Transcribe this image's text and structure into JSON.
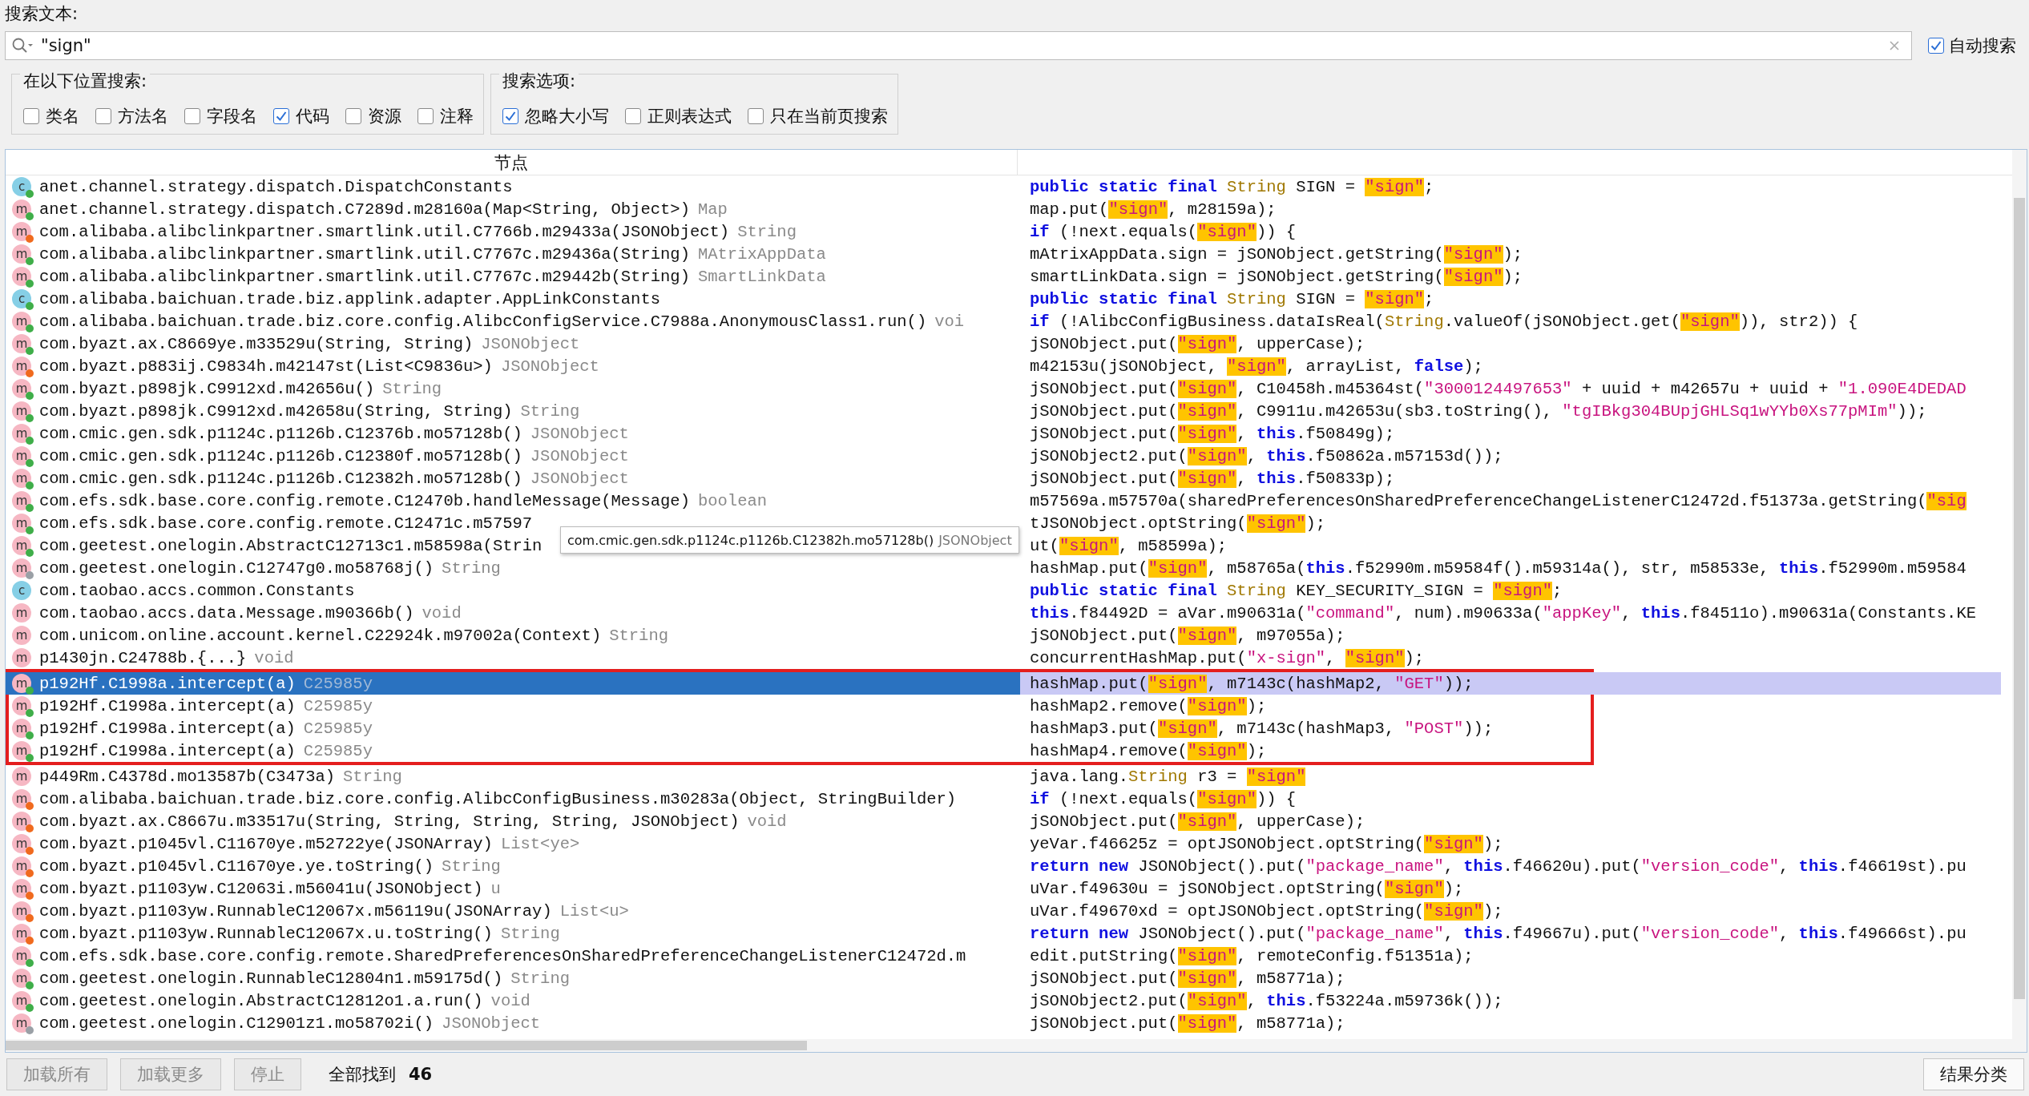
{
  "search": {
    "label": "搜索文本:",
    "value": "\"sign\"",
    "auto_search": {
      "label": "自动搜索",
      "checked": true
    }
  },
  "groups": [
    {
      "title": "在以下位置搜索:",
      "options": [
        {
          "label": "类名",
          "checked": false
        },
        {
          "label": "方法名",
          "checked": false
        },
        {
          "label": "字段名",
          "checked": false
        },
        {
          "label": "代码",
          "checked": true
        },
        {
          "label": "资源",
          "checked": false
        },
        {
          "label": "注释",
          "checked": false
        }
      ]
    },
    {
      "title": "搜索选项:",
      "options": [
        {
          "label": "忽略大小写",
          "checked": true
        },
        {
          "label": "正则表达式",
          "checked": false
        },
        {
          "label": "只在当前页搜索",
          "checked": false
        }
      ]
    }
  ],
  "table": {
    "columns": [
      "节点"
    ]
  },
  "rows": [
    {
      "kind": "class",
      "icon": "c",
      "color": "#3fae49",
      "name": "anet.channel.strategy.dispatch.DispatchConstants",
      "selected": false,
      "boxed": false,
      "code": [
        {
          "kind": "keyword",
          "text": "public static final "
        },
        {
          "kind": "type",
          "text": "String"
        },
        {
          "kind": "plain",
          "text": " SIGN = "
        },
        {
          "kind": "match",
          "text": "\"sign\""
        },
        {
          "kind": "plain",
          "text": ";"
        }
      ]
    },
    {
      "kind": "method",
      "icon": "m",
      "color": "#3fae49",
      "name": "anet.channel.strategy.dispatch.C7289d.m28160a(Map<String, Object>)",
      "type": "Map",
      "selected": false,
      "boxed": false,
      "code": [
        {
          "kind": "plain",
          "text": "map.put("
        },
        {
          "kind": "match",
          "text": "\"sign\""
        },
        {
          "kind": "plain",
          "text": ", m28159a);"
        }
      ]
    },
    {
      "kind": "method",
      "icon": "m",
      "color": "#f06a1e",
      "name": "com.alibaba.alibclinkpartner.smartlink.util.C7766b.m29433a(JSONObject)",
      "type": "String",
      "selected": false,
      "boxed": false,
      "code": [
        {
          "kind": "keyword",
          "text": "if"
        },
        {
          "kind": "plain",
          "text": " (!next.equals("
        },
        {
          "kind": "match",
          "text": "\"sign\""
        },
        {
          "kind": "plain",
          "text": ")) {"
        }
      ]
    },
    {
      "kind": "method",
      "icon": "m",
      "color": "#3fae49",
      "name": "com.alibaba.alibclinkpartner.smartlink.util.C7767c.m29436a(String)",
      "type": "MAtrixAppData",
      "selected": false,
      "boxed": false,
      "code": [
        {
          "kind": "plain",
          "text": "mAtrixAppData.sign = jSONObject.getString("
        },
        {
          "kind": "match",
          "text": "\"sign\""
        },
        {
          "kind": "plain",
          "text": ");"
        }
      ]
    },
    {
      "kind": "method",
      "icon": "m",
      "color": "#3fae49",
      "name": "com.alibaba.alibclinkpartner.smartlink.util.C7767c.m29442b(String)",
      "type": "SmartLinkData",
      "selected": false,
      "boxed": false,
      "code": [
        {
          "kind": "plain",
          "text": "smartLinkData.sign = jSONObject.getString("
        },
        {
          "kind": "match",
          "text": "\"sign\""
        },
        {
          "kind": "plain",
          "text": ");"
        }
      ]
    },
    {
      "kind": "class",
      "icon": "c",
      "color": "#3fae49",
      "name": "com.alibaba.baichuan.trade.biz.applink.adapter.AppLinkConstants",
      "selected": false,
      "boxed": false,
      "code": [
        {
          "kind": "keyword",
          "text": "public static final "
        },
        {
          "kind": "type",
          "text": "String"
        },
        {
          "kind": "plain",
          "text": " SIGN = "
        },
        {
          "kind": "match",
          "text": "\"sign\""
        },
        {
          "kind": "plain",
          "text": ";"
        }
      ]
    },
    {
      "kind": "method",
      "icon": "m",
      "color": "#3fae49",
      "name": "com.alibaba.baichuan.trade.biz.core.config.AlibcConfigService.C7988a.AnonymousClass1.run()",
      "type": "voi",
      "selected": false,
      "boxed": false,
      "code": [
        {
          "kind": "keyword",
          "text": "if"
        },
        {
          "kind": "plain",
          "text": " (!AlibcConfigBusiness.dataIsReal("
        },
        {
          "kind": "type",
          "text": "String"
        },
        {
          "kind": "plain",
          "text": ".valueOf(jSONObject.get("
        },
        {
          "kind": "match",
          "text": "\"sign\""
        },
        {
          "kind": "plain",
          "text": ")), str2)) {"
        }
      ]
    },
    {
      "kind": "method",
      "icon": "m",
      "color": "#3fae49",
      "name": "com.byazt.ax.C8669ye.m33529u(String, String)",
      "type": "JSONObject",
      "selected": false,
      "boxed": false,
      "code": [
        {
          "kind": "plain",
          "text": "jSONObject.put("
        },
        {
          "kind": "match",
          "text": "\"sign\""
        },
        {
          "kind": "plain",
          "text": ", upperCase);"
        }
      ]
    },
    {
      "kind": "method",
      "icon": "m",
      "color": "#f06a1e",
      "name": "com.byazt.p883ij.C9834h.m42147st(List<C9836u>)",
      "type": "JSONObject",
      "selected": false,
      "boxed": false,
      "code": [
        {
          "kind": "plain",
          "text": "m42153u(jSONObject, "
        },
        {
          "kind": "match",
          "text": "\"sign\""
        },
        {
          "kind": "plain",
          "text": ", arrayList, "
        },
        {
          "kind": "keyword",
          "text": "false"
        },
        {
          "kind": "plain",
          "text": ");"
        }
      ]
    },
    {
      "kind": "method",
      "icon": "m",
      "color": "#3fae49",
      "name": "com.byazt.p898jk.C9912xd.m42656u()",
      "type": "String",
      "selected": false,
      "boxed": false,
      "code": [
        {
          "kind": "plain",
          "text": "jSONObject.put("
        },
        {
          "kind": "match",
          "text": "\"sign\""
        },
        {
          "kind": "plain",
          "text": ", C10458h.m45364st("
        },
        {
          "kind": "string",
          "text": "\"3000124497653\""
        },
        {
          "kind": "plain",
          "text": " + uuid + m42657u + uuid + "
        },
        {
          "kind": "string",
          "text": "\"1.090E4DEDAD"
        }
      ]
    },
    {
      "kind": "method",
      "icon": "m",
      "color": "#3fae49",
      "name": "com.byazt.p898jk.C9912xd.m42658u(String, String)",
      "type": "String",
      "selected": false,
      "boxed": false,
      "code": [
        {
          "kind": "plain",
          "text": "jSONObject.put("
        },
        {
          "kind": "match",
          "text": "\"sign\""
        },
        {
          "kind": "plain",
          "text": ", C9911u.m42653u(sb3.toString(), "
        },
        {
          "kind": "string",
          "text": "\"tgIBkg304BUpjGHLSq1wYYb0Xs77pMIm\""
        },
        {
          "kind": "plain",
          "text": "));"
        }
      ]
    },
    {
      "kind": "method",
      "icon": "m",
      "color": "#3fae49",
      "name": "com.cmic.gen.sdk.p1124c.p1126b.C12376b.mo57128b()",
      "type": "JSONObject",
      "selected": false,
      "boxed": false,
      "code": [
        {
          "kind": "plain",
          "text": "jSONObject.put("
        },
        {
          "kind": "match",
          "text": "\"sign\""
        },
        {
          "kind": "plain",
          "text": ", "
        },
        {
          "kind": "keyword",
          "text": "this"
        },
        {
          "kind": "plain",
          "text": ".f50849g);"
        }
      ]
    },
    {
      "kind": "method",
      "icon": "m",
      "color": "#3fae49",
      "name": "com.cmic.gen.sdk.p1124c.p1126b.C12380f.mo57128b()",
      "type": "JSONObject",
      "selected": false,
      "boxed": false,
      "code": [
        {
          "kind": "plain",
          "text": "jSONObject2.put("
        },
        {
          "kind": "match",
          "text": "\"sign\""
        },
        {
          "kind": "plain",
          "text": ", "
        },
        {
          "kind": "keyword",
          "text": "this"
        },
        {
          "kind": "plain",
          "text": ".f50862a.m57153d());"
        }
      ]
    },
    {
      "kind": "method",
      "icon": "m",
      "color": "#3fae49",
      "name": "com.cmic.gen.sdk.p1124c.p1126b.C12382h.mo57128b()",
      "type": "JSONObject",
      "selected": false,
      "boxed": false,
      "code": [
        {
          "kind": "plain",
          "text": "jSONObject.put("
        },
        {
          "kind": "match",
          "text": "\"sign\""
        },
        {
          "kind": "plain",
          "text": ", "
        },
        {
          "kind": "keyword",
          "text": "this"
        },
        {
          "kind": "plain",
          "text": ".f50833p);"
        }
      ]
    },
    {
      "kind": "method",
      "icon": "m",
      "color": "#3fae49",
      "name": "com.efs.sdk.base.core.config.remote.C12470b.handleMessage(Message)",
      "type": "boolean",
      "selected": false,
      "boxed": false,
      "code": [
        {
          "kind": "plain",
          "text": "m57569a.m57570a(sharedPreferencesOnSharedPreferenceChangeListenerC12472d.f51373a.getString("
        },
        {
          "kind": "match",
          "text": "\"sig"
        }
      ]
    },
    {
      "kind": "method",
      "icon": "m",
      "color": "#3fae49",
      "name": "com.efs.sdk.base.core.config.remote.C12471c.m57597",
      "selected": false,
      "boxed": false,
      "code": [
        {
          "kind": "plain",
          "text": "tJSONObject.optString("
        },
        {
          "kind": "match",
          "text": "\"sign\""
        },
        {
          "kind": "plain",
          "text": ");"
        }
      ]
    },
    {
      "kind": "method",
      "icon": "m",
      "color": "#3fae49",
      "name": "com.geetest.onelogin.AbstractC12713c1.m58598a(Strin",
      "selected": false,
      "boxed": false,
      "code": [
        {
          "kind": "plain",
          "text": "ut("
        },
        {
          "kind": "match",
          "text": "\"sign\""
        },
        {
          "kind": "plain",
          "text": ", m58599a);"
        }
      ]
    },
    {
      "kind": "method",
      "icon": "m",
      "color": "#9aa0a6",
      "name": "com.geetest.onelogin.C12747g0.mo58768j()",
      "type": "String",
      "selected": false,
      "boxed": false,
      "code": [
        {
          "kind": "plain",
          "text": "hashMap.put("
        },
        {
          "kind": "match",
          "text": "\"sign\""
        },
        {
          "kind": "plain",
          "text": ", m58765a("
        },
        {
          "kind": "keyword",
          "text": "this"
        },
        {
          "kind": "plain",
          "text": ".f52990m.m59584f().m59314a(), str, m58533e, "
        },
        {
          "kind": "keyword",
          "text": "this"
        },
        {
          "kind": "plain",
          "text": ".f52990m.m59584"
        }
      ]
    },
    {
      "kind": "class",
      "icon": "c",
      "name": "com.taobao.accs.common.Constants",
      "selected": false,
      "boxed": false,
      "code": [
        {
          "kind": "keyword",
          "text": "public static final "
        },
        {
          "kind": "type",
          "text": "String"
        },
        {
          "kind": "plain",
          "text": " KEY_SECURITY_SIGN = "
        },
        {
          "kind": "match",
          "text": "\"sign\""
        },
        {
          "kind": "plain",
          "text": ";"
        }
      ]
    },
    {
      "kind": "method",
      "icon": "m",
      "name": "com.taobao.accs.data.Message.m90366b()",
      "type": "void",
      "selected": false,
      "boxed": false,
      "code": [
        {
          "kind": "keyword",
          "text": "this"
        },
        {
          "kind": "plain",
          "text": ".f84492D = aVar.m90631a("
        },
        {
          "kind": "string",
          "text": "\"command\""
        },
        {
          "kind": "plain",
          "text": ", num).m90633a("
        },
        {
          "kind": "string",
          "text": "\"appKey\""
        },
        {
          "kind": "plain",
          "text": ", "
        },
        {
          "kind": "keyword",
          "text": "this"
        },
        {
          "kind": "plain",
          "text": ".f84511o).m90631a(Constants.KE"
        }
      ]
    },
    {
      "kind": "method",
      "icon": "m",
      "name": "com.unicom.online.account.kernel.C22924k.m97002a(Context)",
      "type": "String",
      "selected": false,
      "boxed": false,
      "code": [
        {
          "kind": "plain",
          "text": "jSONObject.put("
        },
        {
          "kind": "match",
          "text": "\"sign\""
        },
        {
          "kind": "plain",
          "text": ", m97055a);"
        }
      ]
    },
    {
      "kind": "method",
      "icon": "m",
      "name": "p1430jn.C24788b.{...}",
      "type": "void",
      "selected": false,
      "boxed": false,
      "code": [
        {
          "kind": "plain",
          "text": "concurrentHashMap.put("
        },
        {
          "kind": "string",
          "text": "\"x-sign\""
        },
        {
          "kind": "plain",
          "text": ", "
        },
        {
          "kind": "match",
          "text": "\"sign\""
        },
        {
          "kind": "plain",
          "text": ");"
        }
      ]
    },
    {
      "kind": "method",
      "icon": "m",
      "color": "#3fae49",
      "name": "p192Hf.C1998a.intercept(a)",
      "type": "C25985y",
      "selected": true,
      "boxed": true,
      "code": [
        {
          "kind": "plain",
          "text": "hashMap.put("
        },
        {
          "kind": "match",
          "text": "\"sign\""
        },
        {
          "kind": "plain",
          "text": ", m7143c(hashMap2, "
        },
        {
          "kind": "string",
          "text": "\"GET\""
        },
        {
          "kind": "plain",
          "text": "));"
        }
      ]
    },
    {
      "kind": "method",
      "icon": "m",
      "color": "#3fae49",
      "name": "p192Hf.C1998a.intercept(a)",
      "type": "C25985y",
      "selected": false,
      "boxed": true,
      "code": [
        {
          "kind": "plain",
          "text": "hashMap2.remove("
        },
        {
          "kind": "match",
          "text": "\"sign\""
        },
        {
          "kind": "plain",
          "text": ");"
        }
      ]
    },
    {
      "kind": "method",
      "icon": "m",
      "color": "#3fae49",
      "name": "p192Hf.C1998a.intercept(a)",
      "type": "C25985y",
      "selected": false,
      "boxed": true,
      "code": [
        {
          "kind": "plain",
          "text": "hashMap3.put("
        },
        {
          "kind": "match",
          "text": "\"sign\""
        },
        {
          "kind": "plain",
          "text": ", m7143c(hashMap3, "
        },
        {
          "kind": "string",
          "text": "\"POST\""
        },
        {
          "kind": "plain",
          "text": "));"
        }
      ]
    },
    {
      "kind": "method",
      "icon": "m",
      "color": "#3fae49",
      "name": "p192Hf.C1998a.intercept(a)",
      "type": "C25985y",
      "selected": false,
      "boxed": true,
      "code": [
        {
          "kind": "plain",
          "text": "hashMap4.remove("
        },
        {
          "kind": "match",
          "text": "\"sign\""
        },
        {
          "kind": "plain",
          "text": ");"
        }
      ]
    },
    {
      "kind": "method",
      "icon": "m",
      "name": "p449Rm.C4378d.mo13587b(C3473a)",
      "type": "String",
      "selected": false,
      "boxed": false,
      "code": [
        {
          "kind": "plain",
          "text": "java.lang."
        },
        {
          "kind": "type",
          "text": "String"
        },
        {
          "kind": "plain",
          "text": " r3 = "
        },
        {
          "kind": "match",
          "text": "\"sign\""
        }
      ]
    },
    {
      "kind": "method",
      "icon": "m",
      "color": "#f06a1e",
      "name": "com.alibaba.baichuan.trade.biz.core.config.AlibcConfigBusiness.m30283a(Object, StringBuilder)",
      "selected": false,
      "boxed": false,
      "code": [
        {
          "kind": "keyword",
          "text": "if"
        },
        {
          "kind": "plain",
          "text": " (!next.equals("
        },
        {
          "kind": "match",
          "text": "\"sign\""
        },
        {
          "kind": "plain",
          "text": ")) {"
        }
      ]
    },
    {
      "kind": "method",
      "icon": "m",
      "color": "#f06a1e",
      "name": "com.byazt.ax.C8667u.m33517u(String, String, String, String, JSONObject)",
      "type": "void",
      "selected": false,
      "boxed": false,
      "code": [
        {
          "kind": "plain",
          "text": "jSONObject.put("
        },
        {
          "kind": "match",
          "text": "\"sign\""
        },
        {
          "kind": "plain",
          "text": ", upperCase);"
        }
      ]
    },
    {
      "kind": "method",
      "icon": "m",
      "color": "#f06a1e",
      "name": "com.byazt.p1045vl.C11670ye.m52722ye(JSONArray)",
      "type": "List<ye>",
      "selected": false,
      "boxed": false,
      "code": [
        {
          "kind": "plain",
          "text": "yeVar.f46625z = optJSONObject.optString("
        },
        {
          "kind": "match",
          "text": "\"sign\""
        },
        {
          "kind": "plain",
          "text": ");"
        }
      ]
    },
    {
      "kind": "method",
      "icon": "m",
      "color": "#f06a1e",
      "name": "com.byazt.p1045vl.C11670ye.ye.toString()",
      "type": "String",
      "selected": false,
      "boxed": false,
      "code": [
        {
          "kind": "keyword",
          "text": "return new "
        },
        {
          "kind": "plain",
          "text": "JSONObject().put("
        },
        {
          "kind": "string",
          "text": "\"package_name\""
        },
        {
          "kind": "plain",
          "text": ", "
        },
        {
          "kind": "keyword",
          "text": "this"
        },
        {
          "kind": "plain",
          "text": ".f46620u).put("
        },
        {
          "kind": "string",
          "text": "\"version_code\""
        },
        {
          "kind": "plain",
          "text": ", "
        },
        {
          "kind": "keyword",
          "text": "this"
        },
        {
          "kind": "plain",
          "text": ".f46619st).pu"
        }
      ]
    },
    {
      "kind": "method",
      "icon": "m",
      "color": "#f06a1e",
      "name": "com.byazt.p1103yw.C12063i.m56041u(JSONObject)",
      "type": "u",
      "selected": false,
      "boxed": false,
      "code": [
        {
          "kind": "plain",
          "text": "uVar.f49630u = jSONObject.optString("
        },
        {
          "kind": "match",
          "text": "\"sign\""
        },
        {
          "kind": "plain",
          "text": ");"
        }
      ]
    },
    {
      "kind": "method",
      "icon": "m",
      "color": "#f06a1e",
      "name": "com.byazt.p1103yw.RunnableC12067x.m56119u(JSONArray)",
      "type": "List<u>",
      "selected": false,
      "boxed": false,
      "code": [
        {
          "kind": "plain",
          "text": "uVar.f49670xd = optJSONObject.optString("
        },
        {
          "kind": "match",
          "text": "\"sign\""
        },
        {
          "kind": "plain",
          "text": ");"
        }
      ]
    },
    {
      "kind": "method",
      "icon": "m",
      "color": "#f06a1e",
      "name": "com.byazt.p1103yw.RunnableC12067x.u.toString()",
      "type": "String",
      "selected": false,
      "boxed": false,
      "code": [
        {
          "kind": "keyword",
          "text": "return new "
        },
        {
          "kind": "plain",
          "text": "JSONObject().put("
        },
        {
          "kind": "string",
          "text": "\"package_name\""
        },
        {
          "kind": "plain",
          "text": ", "
        },
        {
          "kind": "keyword",
          "text": "this"
        },
        {
          "kind": "plain",
          "text": ".f49667u).put("
        },
        {
          "kind": "string",
          "text": "\"version_code\""
        },
        {
          "kind": "plain",
          "text": ", "
        },
        {
          "kind": "keyword",
          "text": "this"
        },
        {
          "kind": "plain",
          "text": ".f49666st).pu"
        }
      ]
    },
    {
      "kind": "method",
      "icon": "m",
      "color": "#3fae49",
      "name": "com.efs.sdk.base.core.config.remote.SharedPreferencesOnSharedPreferenceChangeListenerC12472d.m",
      "selected": false,
      "boxed": false,
      "code": [
        {
          "kind": "plain",
          "text": "edit.putString("
        },
        {
          "kind": "match",
          "text": "\"sign\""
        },
        {
          "kind": "plain",
          "text": ", remoteConfig.f51351a);"
        }
      ]
    },
    {
      "kind": "method",
      "icon": "m",
      "color": "#3fae49",
      "name": "com.geetest.onelogin.RunnableC12804n1.m59175d()",
      "type": "String",
      "selected": false,
      "boxed": false,
      "code": [
        {
          "kind": "plain",
          "text": "jSONObject.put("
        },
        {
          "kind": "match",
          "text": "\"sign\""
        },
        {
          "kind": "plain",
          "text": ", m58771a);"
        }
      ]
    },
    {
      "kind": "method",
      "icon": "m",
      "color": "#3fae49",
      "name": "com.geetest.onelogin.AbstractC12812o1.a.run()",
      "type": "void",
      "selected": false,
      "boxed": false,
      "code": [
        {
          "kind": "plain",
          "text": "jSONObject2.put("
        },
        {
          "kind": "match",
          "text": "\"sign\""
        },
        {
          "kind": "plain",
          "text": ", "
        },
        {
          "kind": "keyword",
          "text": "this"
        },
        {
          "kind": "plain",
          "text": ".f53224a.m59736k());"
        }
      ]
    },
    {
      "kind": "method",
      "icon": "m",
      "color": "#9aa0a6",
      "name": "com.geetest.onelogin.C12901z1.mo58702i()",
      "type": "JSONObject",
      "selected": false,
      "boxed": false,
      "code": [
        {
          "kind": "plain",
          "text": "jSONObject.put("
        },
        {
          "kind": "match",
          "text": "\"sign\""
        },
        {
          "kind": "plain",
          "text": ", m58771a);"
        }
      ]
    }
  ],
  "tooltip": {
    "text": "com.cmic.gen.sdk.p1124c.p1126b.C12382h.mo57128b()",
    "type": "JSONObject"
  },
  "footer": {
    "buttons": [
      {
        "label": "加载所有",
        "disabled": true
      },
      {
        "label": "加载更多",
        "disabled": true
      },
      {
        "label": "停止",
        "disabled": true
      }
    ],
    "found_label": "全部找到",
    "found_count": "46",
    "group_button": "结果分类"
  }
}
